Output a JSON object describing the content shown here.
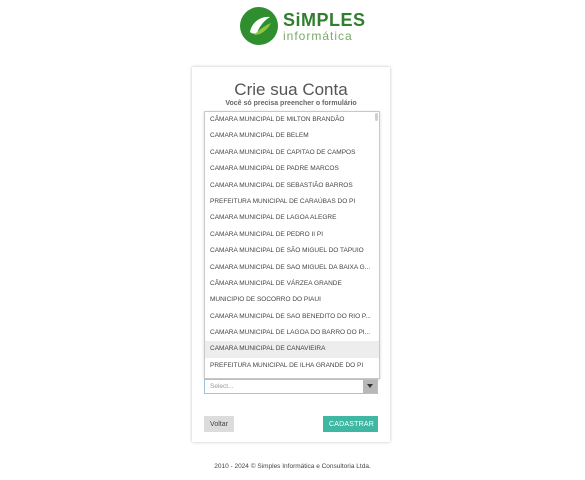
{
  "logo": {
    "brand": "SiMPLES",
    "sub": "informática"
  },
  "form": {
    "title": "Crie sua Conta",
    "subtitle": "Você só precisa preencher o formulário",
    "select_placeholder": "Select...",
    "options": [
      "CÂMARA MUNICIPAL DE MILTON BRANDÃO",
      "CAMARA MUNICIPAL DE BELEM",
      "CAMARA MUNICIPAL DE CAPITAO DE CAMPOS",
      "CAMARA MUNICIPAL DE PADRE MARCOS",
      "CAMARA MUNICIPAL DE SEBASTIÃO BARROS",
      "PREFEITURA MUNICIPAL DE CARAÚBAS DO PI",
      "CAMARA MUNICIPAL DE LAGOA ALEGRE",
      "CAMARA MUNICIPAL DE PEDRO II PI",
      "CAMARA MUNICIPAL DE SÃO MIGUEL DO TAPUIO",
      "CAMARA MUNICIPAL DE SAO MIGUEL DA BAIXA G...",
      "CÂMARA MUNICIPAL DE VÁRZEA GRANDE",
      "MUNICIPIO DE SOCORRO DO PIAUI",
      "CAMARA MUNICIPAL DE SAO BENEDITO DO RIO P...",
      "CAMARA MUNICIPAL DE LAGOA DO BARRO DO PI...",
      "CAMARA MUNICIPAL DE CANAVIEIRA",
      "PREFEITURA MUNICIPAL DE ILHA GRANDE DO PI"
    ],
    "hovered_option_index": 14,
    "back_label": "Voltar",
    "submit_label": "CADASTRAR"
  },
  "footer": {
    "text": "2010 - 2024 © Simples Informática e Consultoria Ltda."
  },
  "colors": {
    "brand_green": "#2f8f2f",
    "submit_teal": "#3fb7a3"
  }
}
